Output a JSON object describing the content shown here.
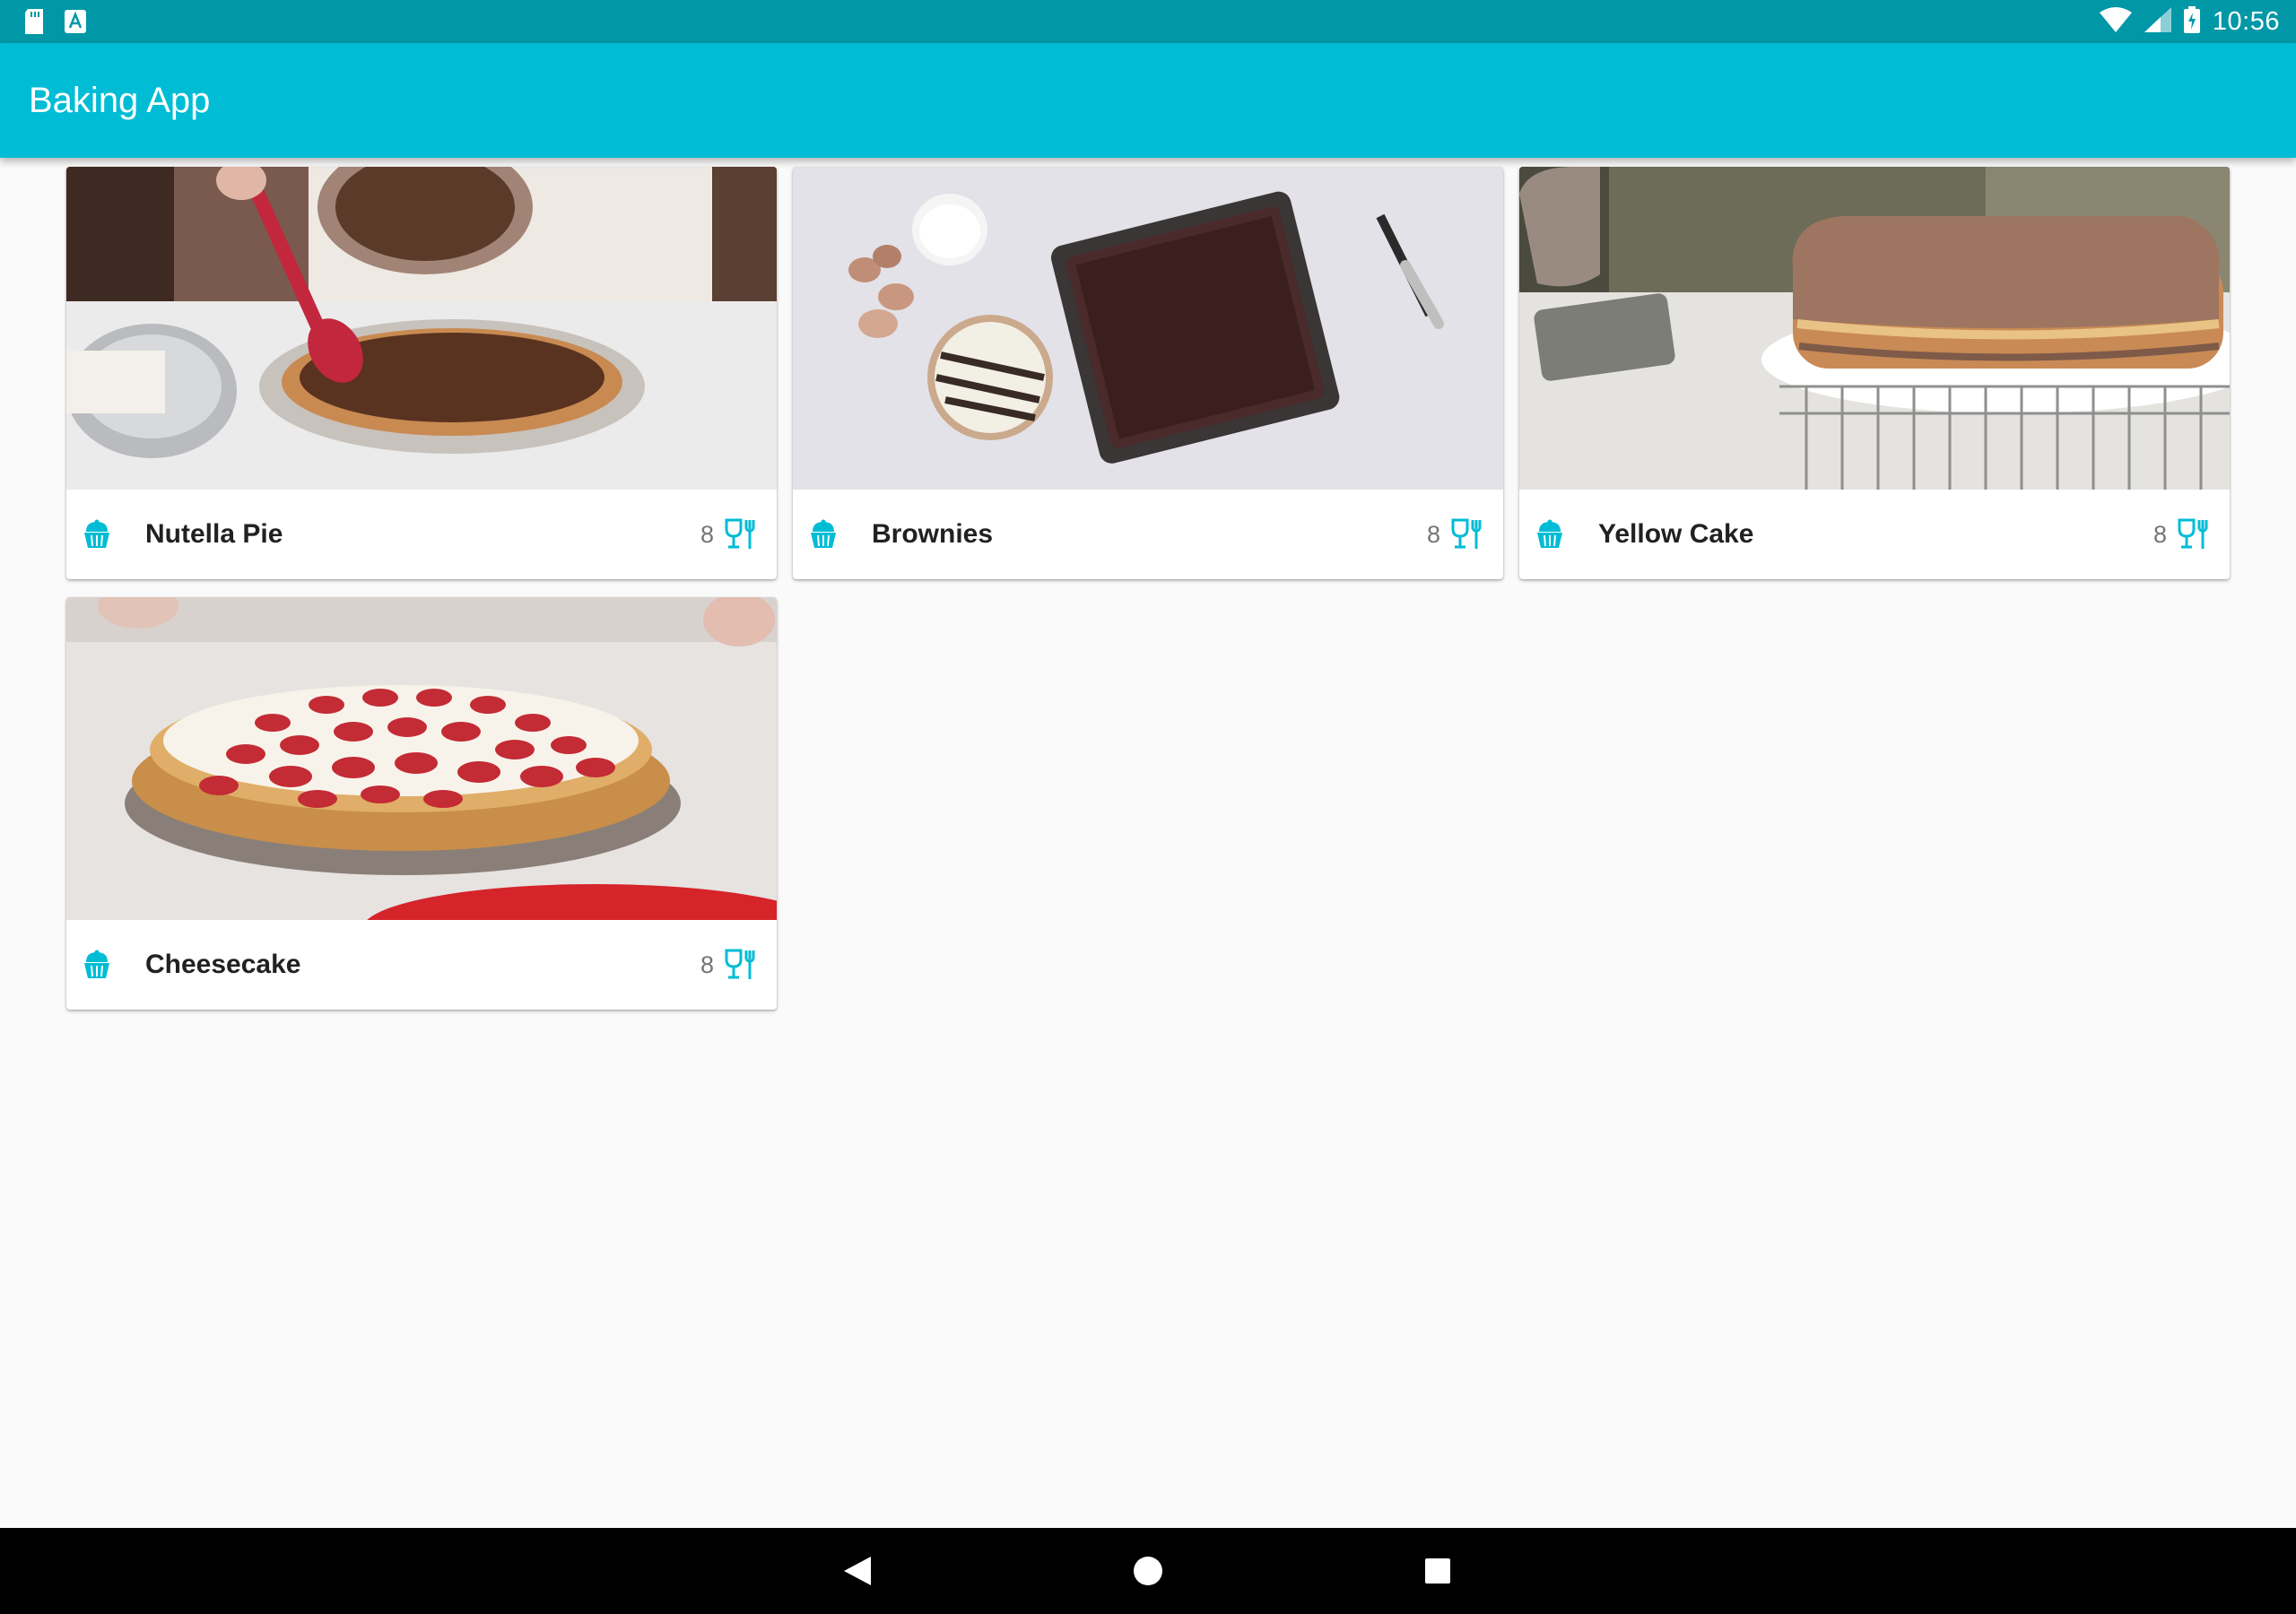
{
  "status_bar": {
    "time": "10:56",
    "icons": [
      "sd-card-icon",
      "a-badge-icon",
      "wifi-icon",
      "cell-signal-icon",
      "battery-icon"
    ]
  },
  "app_bar": {
    "title": "Baking App"
  },
  "recipes": [
    {
      "name": "Nutella Pie",
      "servings": "8"
    },
    {
      "name": "Brownies",
      "servings": "8"
    },
    {
      "name": "Yellow Cake",
      "servings": "8"
    },
    {
      "name": "Cheesecake",
      "servings": "8"
    }
  ],
  "colors": {
    "status_bar": "#0097a7",
    "app_bar": "#00bcd4",
    "accent_icon": "#00bcd4",
    "background": "#fafafa"
  },
  "nav_bar": {
    "buttons": [
      "back",
      "home",
      "recents"
    ]
  }
}
